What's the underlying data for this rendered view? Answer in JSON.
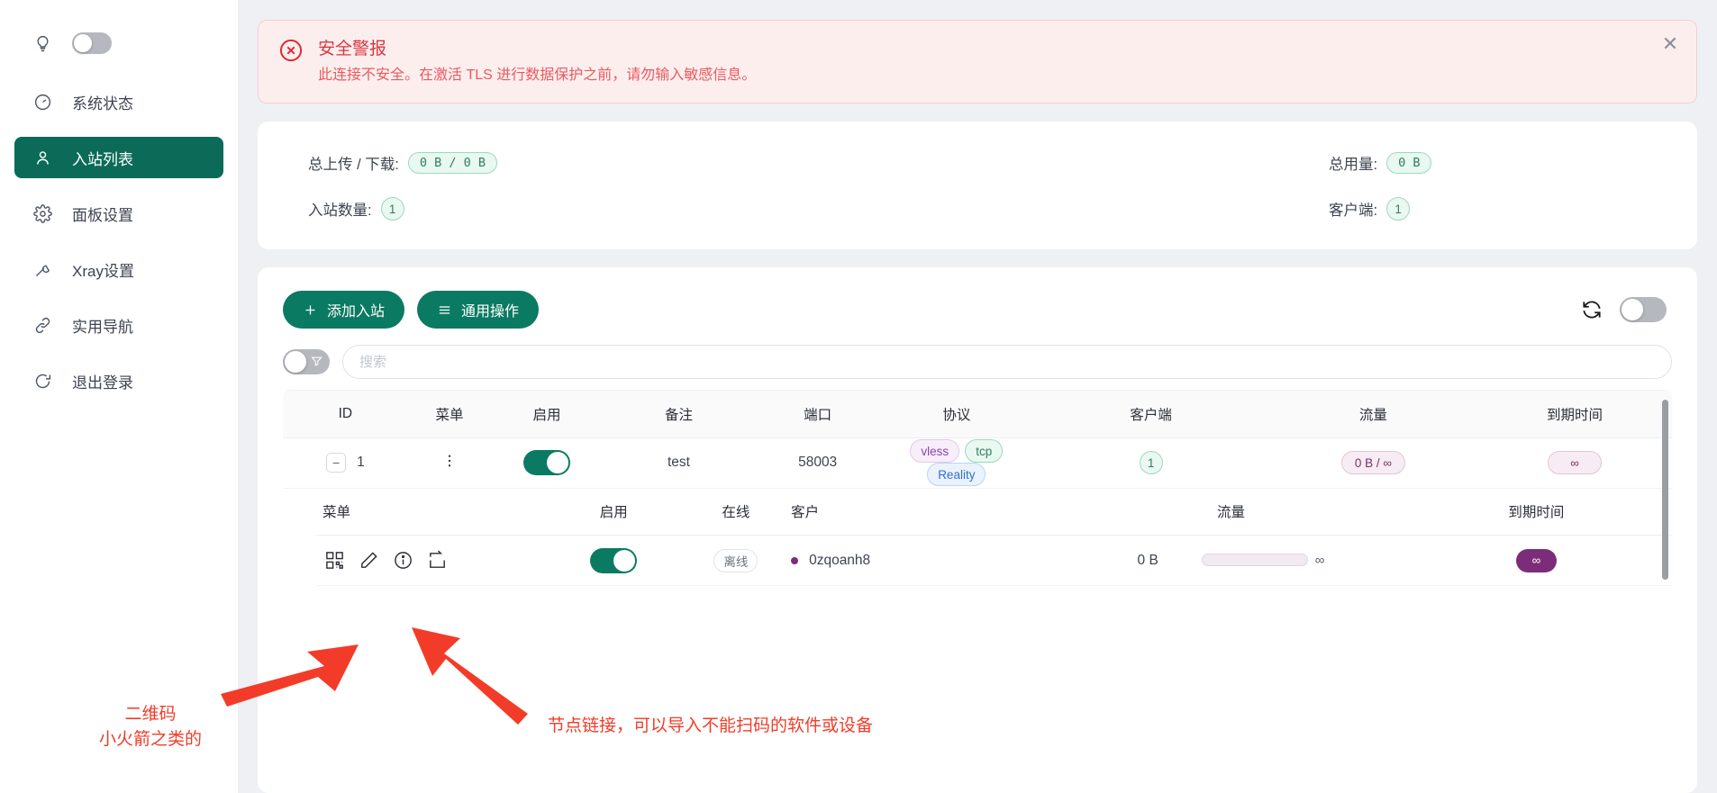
{
  "sidebar": {
    "theme_toggle": {
      "icon": "bulb-icon",
      "state": "off"
    },
    "items": [
      {
        "label": "系统状态",
        "icon": "gauge-icon",
        "active": false
      },
      {
        "label": "入站列表",
        "icon": "user-icon",
        "active": true
      },
      {
        "label": "面板设置",
        "icon": "gear-icon",
        "active": false
      },
      {
        "label": "Xray设置",
        "icon": "wrench-icon",
        "active": false
      },
      {
        "label": "实用导航",
        "icon": "link-icon",
        "active": false
      },
      {
        "label": "退出登录",
        "icon": "logout-icon",
        "active": false
      }
    ]
  },
  "alert": {
    "icon": "error-circle-icon",
    "title": "安全警报",
    "description": "此连接不安全。在激活 TLS 进行数据保护之前，请勿输入敏感信息。",
    "close_icon": "close-icon",
    "color": "#d9363e"
  },
  "stats": [
    {
      "label": "总上传 / 下载:",
      "value": "0 B / 0 B",
      "shape": "pill"
    },
    {
      "label": "总用量:",
      "value": "0 B",
      "shape": "pill"
    },
    {
      "label": "入站数量:",
      "value": "1",
      "shape": "circle"
    },
    {
      "label": "客户端:",
      "value": "1",
      "shape": "circle"
    }
  ],
  "toolbar": {
    "add_inbound_label": "添加入站",
    "add_inbound_icon": "plus-icon",
    "general_actions_label": "通用操作",
    "general_actions_icon": "menu-icon",
    "refresh_icon": "refresh-icon",
    "auto_refresh_state": "off"
  },
  "search": {
    "placeholder": "搜索",
    "value": "",
    "filter_icon": "filter-icon",
    "filter_state": "off"
  },
  "table": {
    "headers": [
      "ID",
      "菜单",
      "启用",
      "备注",
      "端口",
      "协议",
      "客户端",
      "流量",
      "到期时间"
    ],
    "rows": [
      {
        "expand_icon": "minus-icon",
        "id": "1",
        "menu_icon": "kebab-icon",
        "enabled": "on",
        "remark": "test",
        "port": "58003",
        "protocols": [
          "vless",
          "tcp",
          "Reality"
        ],
        "clients": "1",
        "traffic": "0 B / ∞",
        "expiry": "∞"
      }
    ]
  },
  "sub_table": {
    "headers": [
      "菜单",
      "启用",
      "在线",
      "客户",
      "流量",
      "到期时间"
    ],
    "rows": [
      {
        "actions": [
          "qrcode-icon",
          "edit-icon",
          "info-icon",
          "share-link-icon"
        ],
        "enabled": "on",
        "online_status": "离线",
        "client_name": "0zqoanh8",
        "traffic_used": "0 B",
        "traffic_limit": "∞",
        "expiry": "∞"
      }
    ]
  },
  "annotations": {
    "color": "#f23c29",
    "left": {
      "line1": "二维码",
      "line2": "小火箭之类的"
    },
    "right": {
      "line1": "节点链接，可以导入不能扫码的软件或设备"
    }
  }
}
